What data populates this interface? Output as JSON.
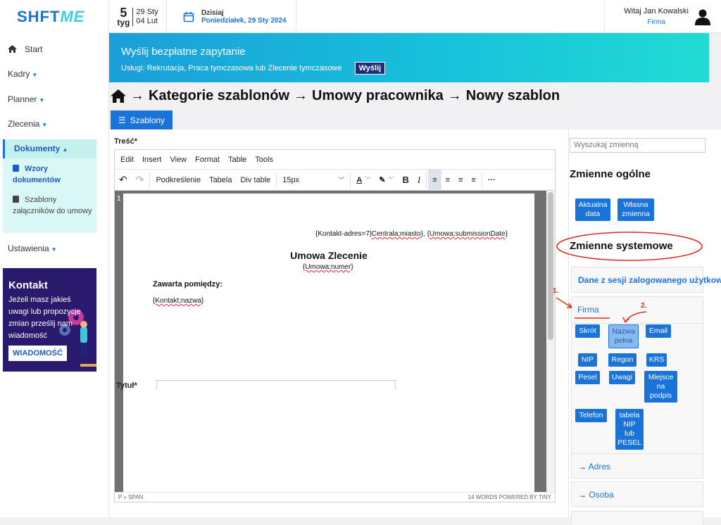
{
  "brand": {
    "logo_part1": "SHFT",
    "logo_part2": "ME"
  },
  "topbar": {
    "week_num": "5",
    "week_label": "tyg",
    "week_start": "29 Sty",
    "week_end": "04 Lut",
    "today_label": "Dzisiaj",
    "today_date": "Poniedziałek, 29 Sty 2024",
    "user_greeting": "Witaj Jan Kowalski",
    "user_role": "Firma"
  },
  "sidebar": {
    "start": "Start",
    "kadry": "Kadry",
    "planner": "Planner",
    "zlecenia": "Zlecenia",
    "dokumenty": "Dokumenty",
    "wzory": "Wzory dokumentów",
    "szablony": "Szablony załączników do umowy",
    "ustawienia": "Ustawienia"
  },
  "kontakt": {
    "title": "Kontakt",
    "body": "Jeżeli masz jakieś uwagi lub propozycje zmian prześlij nam wiadomość",
    "button": "WIADOMOŚĆ"
  },
  "banner": {
    "title": "Wyślij bezpłatne zapytanie",
    "subtitle": "Usługi: Rekrutacja, Praca tymczasowa lub Zlecenie tymczasowe",
    "button": "Wyślij"
  },
  "breadcrumb": {
    "c1": "Kategorie szablonów",
    "c2": "Umowy pracownika",
    "c3": "Nowy szablon"
  },
  "tab": {
    "label": "Szablony"
  },
  "editor": {
    "label": "Treść*",
    "menu": [
      "Edit",
      "Insert",
      "View",
      "Format",
      "Table",
      "Tools"
    ],
    "tb_underline": "Podkreślenie",
    "tb_table": "Tabela",
    "tb_divtable": "Div table",
    "tb_fontsize": "15px",
    "line_no": "1",
    "status_left": "P » SPAN",
    "status_right": "14 WORDS  POWERED BY TINY",
    "content": {
      "header_line_a": "{Kontakt-adres=7|",
      "header_line_b": "Centrala;miasto",
      "header_line_c": "}, {",
      "header_line_d": "Umowa;submissionDate",
      "header_line_e": "}",
      "title": "Umowa Zlecenie",
      "number": "{Umowa;numer}",
      "zawarta": "Zawarta pomiędzy:",
      "party": "{Kontakt;nazwa}"
    }
  },
  "form": {
    "tytul_label": "Tytuł*"
  },
  "variables": {
    "search_placeholder": "Wyszukaj zmienną",
    "general_title": "Zmienne ogólne",
    "general": [
      "Aktualna data",
      "Własna zmienna"
    ],
    "system_title": "Zmienne systemowe",
    "session_label": "Dane z sesji zalogowanego użytkownika",
    "firma_label": "Firma",
    "firma": [
      "Skrót",
      "Nazwa pełna",
      "Email",
      "NIP",
      "Regon",
      "KRS",
      "Pesel",
      "Uwagi",
      "Miejsce na podpis",
      "Telefon",
      "tabela NIP lub PESEL"
    ],
    "adres": "Adres",
    "osoba": "Osoba",
    "annotation_1": "1.",
    "annotation_2": "2."
  },
  "colors": {
    "accent": "#1a73d9",
    "annotation": "#e0281a",
    "kontakt_bg": "#2a1a6e"
  }
}
